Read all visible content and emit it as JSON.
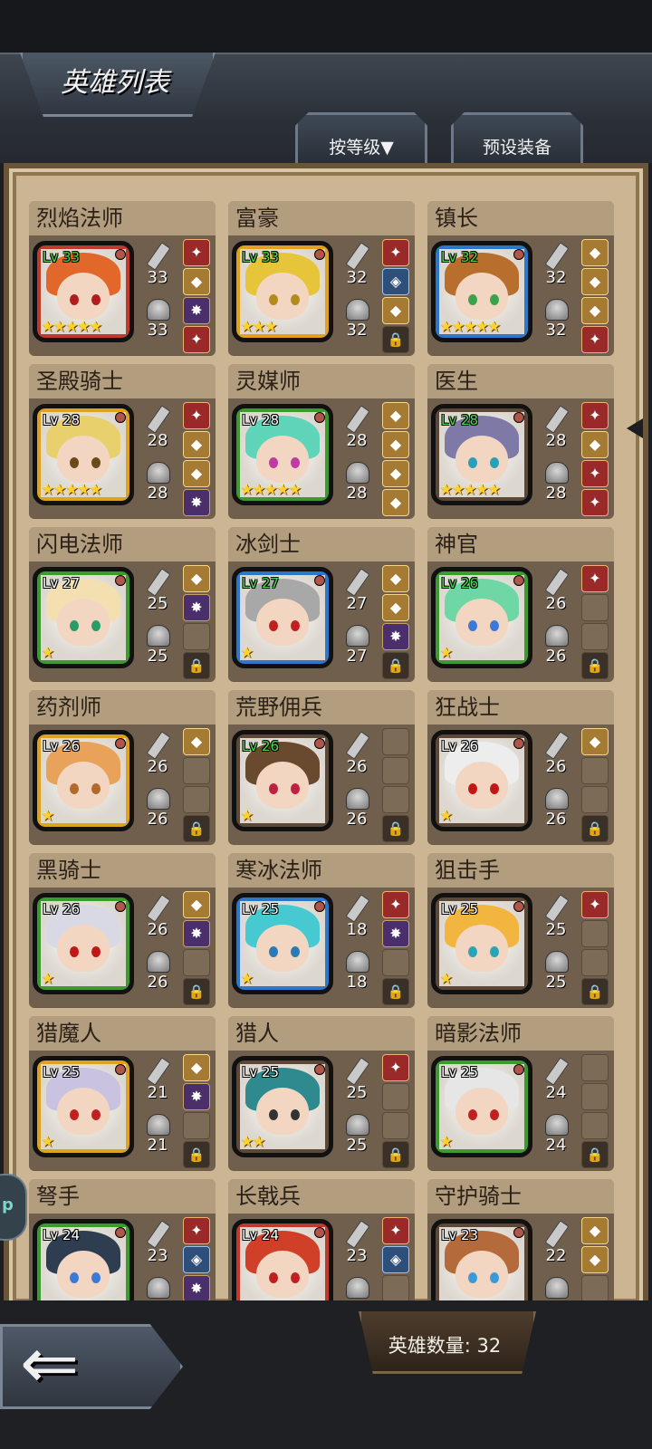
{
  "header": {
    "title": "英雄列表",
    "sort_tab": "按等级▼",
    "preset_tab": "预设装备"
  },
  "footer": {
    "hero_count": "英雄数量: 32",
    "back_arrow": "⇐"
  },
  "side_bubble_text": "p",
  "colors": {
    "panel": "#cbb592",
    "frame_gold": "#e0a21c",
    "frame_blue": "#2c77c9",
    "frame_green": "#3c9a2e",
    "frame_brown": "#5d4736",
    "frame_red": "#c0392b",
    "star": "#ffd22a"
  },
  "heroes": [
    {
      "name": "烈焰法师",
      "lv": "Lv 33",
      "lv_green": true,
      "frame": "red",
      "stars": "★★★★★",
      "atk": "33",
      "def": "33",
      "hair": "#e1682a",
      "eye": "#b21c1c",
      "equip": [
        "red",
        "gold",
        "purple",
        "red"
      ]
    },
    {
      "name": "富豪",
      "lv": "Lv 33",
      "lv_green": true,
      "frame": "gold",
      "stars": "★★★",
      "atk": "32",
      "def": "32",
      "hair": "#e7c53a",
      "eye": "#b28b1c",
      "equip": [
        "red",
        "blue",
        "gold",
        "lock"
      ]
    },
    {
      "name": "镇长",
      "lv": "Lv 32",
      "lv_green": true,
      "frame": "blue",
      "stars": "★★★★★",
      "atk": "32",
      "def": "32",
      "hair": "#b86e2c",
      "eye": "#3aa24a",
      "equip": [
        "gold",
        "gold",
        "gold",
        "red"
      ]
    },
    {
      "name": "圣殿骑士",
      "lv": "Lv 28",
      "lv_green": false,
      "frame": "gold",
      "stars": "★★★★★",
      "atk": "28",
      "def": "28",
      "hair": "#e8d06c",
      "eye": "#6b4b1c",
      "equip": [
        "red",
        "gold",
        "gold",
        "purple"
      ]
    },
    {
      "name": "灵媒师",
      "lv": "Lv 28",
      "lv_green": false,
      "frame": "green",
      "stars": "★★★★★",
      "atk": "28",
      "def": "28",
      "hair": "#5fd4b9",
      "eye": "#c03aa6",
      "equip": [
        "gold",
        "gold",
        "gold",
        "gold"
      ]
    },
    {
      "name": "医生",
      "lv": "Lv 28",
      "lv_green": true,
      "frame": "brown",
      "stars": "★★★★★",
      "atk": "28",
      "def": "28",
      "hair": "#7f79a8",
      "eye": "#2aa0b8",
      "equip": [
        "red",
        "gold",
        "red",
        "red"
      ]
    },
    {
      "name": "闪电法师",
      "lv": "Lv 27",
      "lv_green": false,
      "frame": "green",
      "stars": "★",
      "atk": "25",
      "def": "25",
      "hair": "#f4dfb0",
      "eye": "#2a9c6a",
      "equip": [
        "gold",
        "purple",
        "empty",
        "lock"
      ]
    },
    {
      "name": "冰剑士",
      "lv": "Lv 27",
      "lv_green": true,
      "frame": "blue",
      "stars": "★",
      "atk": "27",
      "def": "27",
      "hair": "#a8a8a8",
      "eye": "#c02020",
      "equip": [
        "gold",
        "gold",
        "purple",
        "lock"
      ]
    },
    {
      "name": "神官",
      "lv": "Lv 26",
      "lv_green": true,
      "frame": "green",
      "stars": "★",
      "atk": "26",
      "def": "26",
      "hair": "#6fd6a6",
      "eye": "#3a7ad8",
      "equip": [
        "red",
        "empty",
        "empty",
        "lock"
      ]
    },
    {
      "name": "药剂师",
      "lv": "Lv 26",
      "lv_green": false,
      "frame": "gold",
      "stars": "★",
      "atk": "26",
      "def": "26",
      "hair": "#e8a25a",
      "eye": "#b06a2a",
      "equip": [
        "gold",
        "empty",
        "empty",
        "lock"
      ]
    },
    {
      "name": "荒野佣兵",
      "lv": "Lv 26",
      "lv_green": true,
      "frame": "brown",
      "stars": "★",
      "atk": "26",
      "def": "26",
      "hair": "#6a4a2e",
      "eye": "#c02040",
      "equip": [
        "empty",
        "empty",
        "empty",
        "lock"
      ]
    },
    {
      "name": "狂战士",
      "lv": "Lv 26",
      "lv_green": false,
      "frame": "brown",
      "stars": "★",
      "atk": "26",
      "def": "26",
      "hair": "#ededed",
      "eye": "#c01818",
      "equip": [
        "gold",
        "empty",
        "empty",
        "lock"
      ]
    },
    {
      "name": "黑骑士",
      "lv": "Lv 26",
      "lv_green": false,
      "frame": "green",
      "stars": "★",
      "atk": "26",
      "def": "26",
      "hair": "#d9d9e6",
      "eye": "#c01818",
      "equip": [
        "gold",
        "purple",
        "empty",
        "lock"
      ]
    },
    {
      "name": "寒冰法师",
      "lv": "Lv 25",
      "lv_green": false,
      "frame": "blue",
      "stars": "★",
      "atk": "18",
      "def": "18",
      "hair": "#46c9d0",
      "eye": "#2a7ab8",
      "equip": [
        "red",
        "purple",
        "empty",
        "lock"
      ]
    },
    {
      "name": "狙击手",
      "lv": "Lv 25",
      "lv_green": false,
      "frame": "brown",
      "stars": "★",
      "atk": "25",
      "def": "25",
      "hair": "#f2b640",
      "eye": "#2aa4b8",
      "equip": [
        "red",
        "empty",
        "empty",
        "lock"
      ]
    },
    {
      "name": "猎魔人",
      "lv": "Lv 25",
      "lv_green": false,
      "frame": "gold",
      "stars": "★",
      "atk": "21",
      "def": "21",
      "hair": "#c9c2e0",
      "eye": "#c02020",
      "equip": [
        "gold",
        "purple",
        "empty",
        "lock"
      ]
    },
    {
      "name": "猎人",
      "lv": "Lv 25",
      "lv_green": false,
      "frame": "brown",
      "stars": "★★",
      "atk": "25",
      "def": "25",
      "hair": "#2e8a8e",
      "eye": "#333333",
      "equip": [
        "red",
        "empty",
        "empty",
        "lock"
      ]
    },
    {
      "name": "暗影法师",
      "lv": "Lv 25",
      "lv_green": false,
      "frame": "green",
      "stars": "★",
      "atk": "24",
      "def": "24",
      "hair": "#e6e6e6",
      "eye": "#c02020",
      "equip": [
        "empty",
        "empty",
        "empty",
        "lock"
      ]
    },
    {
      "name": "弩手",
      "lv": "Lv 24",
      "lv_green": false,
      "frame": "green",
      "stars": "",
      "atk": "23",
      "def": "",
      "hair": "#2e3e50",
      "eye": "#3a7ad8",
      "equip": [
        "red",
        "blue",
        "purple",
        "empty"
      ]
    },
    {
      "name": "长戟兵",
      "lv": "Lv 24",
      "lv_green": false,
      "frame": "red",
      "stars": "",
      "atk": "23",
      "def": "",
      "hair": "#d04028",
      "eye": "#c02020",
      "equip": [
        "red",
        "blue",
        "empty",
        "empty"
      ]
    },
    {
      "name": "守护骑士",
      "lv": "Lv 23",
      "lv_green": false,
      "frame": "brown",
      "stars": "",
      "atk": "22",
      "def": "",
      "hair": "#b46a3a",
      "eye": "#3a9ad8",
      "equip": [
        "gold",
        "gold",
        "empty",
        "empty"
      ]
    }
  ]
}
